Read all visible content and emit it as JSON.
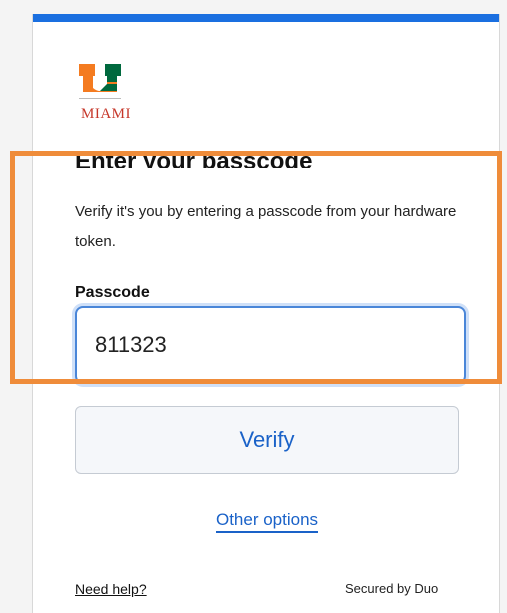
{
  "brand": {
    "logo_text": "MIAMI",
    "accent_color": "#1a6fe0",
    "logo_orange": "#f47b20",
    "logo_green": "#00693e"
  },
  "page": {
    "title": "Enter your passcode",
    "description": "Verify it's you by entering a passcode from your hardware token."
  },
  "passcode": {
    "label": "Passcode",
    "value": "811323"
  },
  "actions": {
    "verify_label": "Verify",
    "other_options_label": "Other options"
  },
  "footer": {
    "help_label": "Need help?",
    "secured_label": "Secured by Duo"
  },
  "annotation": {
    "highlight_color": "#ef8c3a"
  }
}
